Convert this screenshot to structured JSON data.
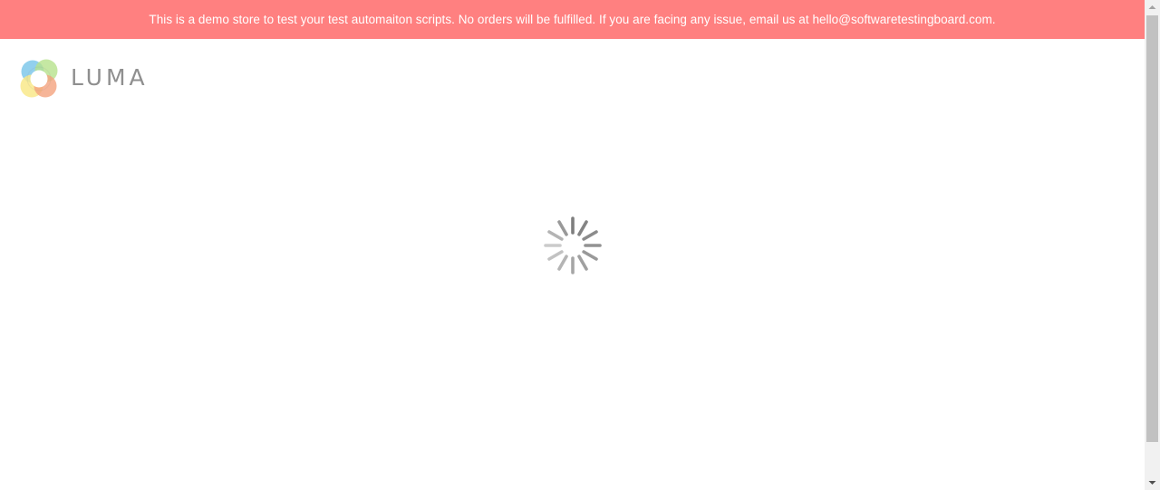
{
  "banner": {
    "text": "This is a demo store to test your test automaiton scripts. No orders will be fulfilled. If you are facing any issue, email us at hello@softwaretestingboard.com."
  },
  "header": {
    "logo_text": "LUMA",
    "logo_icon": "luma-logo-icon"
  },
  "loader": {
    "icon": "loading-spinner-icon"
  },
  "colors": {
    "banner_bg": "#ff8080",
    "banner_text": "#ffffff",
    "logo_text": "#8f8f8f",
    "spinner": "#6d6d6d"
  }
}
